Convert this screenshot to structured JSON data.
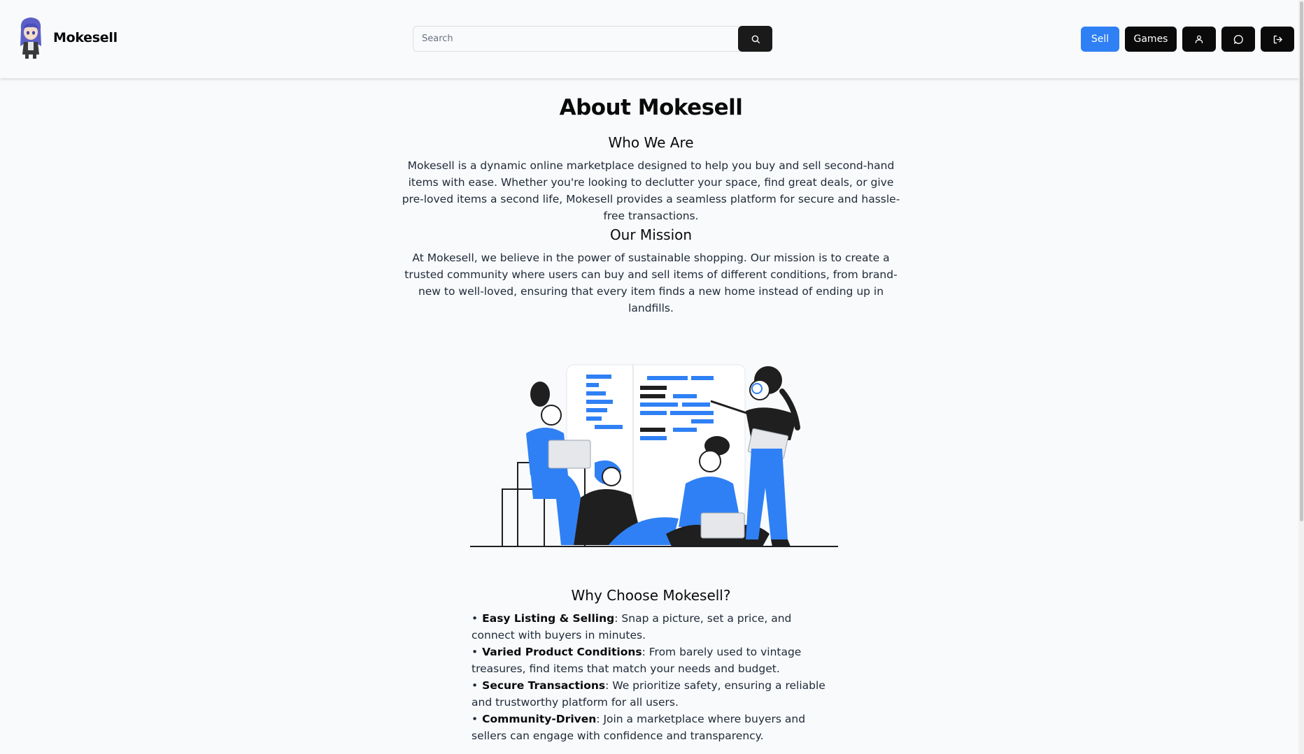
{
  "header": {
    "brand_name": "Mokesell",
    "avatar_icon": "anime-avatar-icon",
    "search": {
      "placeholder": "Search",
      "value": "",
      "button_icon": "search-icon"
    },
    "nav": {
      "sell_label": "Sell",
      "games_label": "Games",
      "profile_icon": "user-icon",
      "chat_icon": "chat-bubble-icon",
      "logout_icon": "logout-icon"
    }
  },
  "colors": {
    "accent": "#2f80f5",
    "dark": "#0a0a0a",
    "background": "#f8fafc"
  },
  "main": {
    "title": "About Mokesell",
    "sections": [
      {
        "heading": "Who We Are",
        "body": "Mokesell is a dynamic online marketplace designed to help you buy and sell second-hand items with ease. Whether you're looking to declutter your space, find great deals, or give pre-loved items a second life, Mokesell provides a seamless platform for secure and hassle-free transactions."
      },
      {
        "heading": "Our Mission",
        "body": "At Mokesell, we believe in the power of sustainable shopping. Our mission is to create a trusted community where users can buy and sell items of different conditions, from brand-new to well-loved, ensuring that every item finds a new home instead of ending up in landfills."
      }
    ],
    "illustration": "team-collaboration-illustration",
    "why": {
      "heading": "Why Choose Mokesell?",
      "items": [
        {
          "title": "Easy Listing & Selling",
          "text": ": Snap a picture, set a price, and connect with buyers in minutes."
        },
        {
          "title": "Varied Product Conditions",
          "text": ": From barely used to vintage treasures, find items that match your needs and budget."
        },
        {
          "title": "Secure Transactions",
          "text": ": We prioritize safety, ensuring a reliable and trustworthy platform for all users."
        },
        {
          "title": "Community-Driven",
          "text": ": Join a marketplace where buyers and sellers can engage with confidence and transparency."
        }
      ]
    }
  }
}
